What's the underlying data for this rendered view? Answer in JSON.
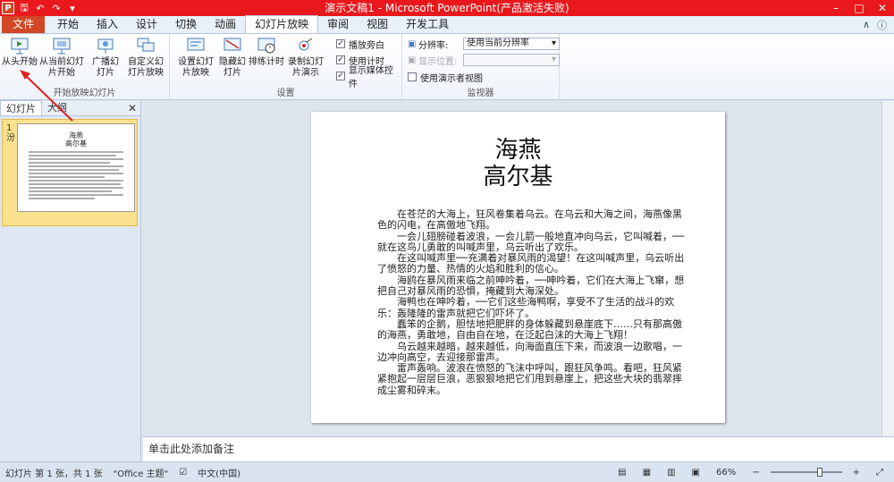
{
  "window": {
    "title": "演示文稿1 - Microsoft PowerPoint(产品激活失败)",
    "app_logo": "P",
    "controls": [
      "minimize",
      "maximize",
      "close"
    ]
  },
  "qat": {
    "save": "save-icon",
    "undo": "undo-icon",
    "redo": "redo-icon"
  },
  "tabs": [
    {
      "label": "文件"
    },
    {
      "label": "开始"
    },
    {
      "label": "插入"
    },
    {
      "label": "设计"
    },
    {
      "label": "切换"
    },
    {
      "label": "动画"
    },
    {
      "label": "幻灯片放映"
    },
    {
      "label": "审阅"
    },
    {
      "label": "视图"
    },
    {
      "label": "开发工具"
    }
  ],
  "ribbon": {
    "group_start": {
      "label": "开始放映幻灯片",
      "from_beginning": "从头开始",
      "from_current": "从当前幻灯片开始",
      "broadcast": "广播幻灯片",
      "custom": "自定义幻灯片放映"
    },
    "group_setup": {
      "label": "设置",
      "setup_show": "设置幻灯片放映",
      "hide_slide": "隐藏幻灯片",
      "rehearse": "排练计时",
      "record": "录制幻灯片演示",
      "play_narrations": "播放旁白",
      "use_timings": "使用计时",
      "show_media": "显示媒体控件"
    },
    "group_monitors": {
      "label": "监视器",
      "resolution_label": "分辨率:",
      "resolution_value": "使用当前分辨率",
      "show_on_label": "显示位置:",
      "presenter_view": "使用演示者视图"
    }
  },
  "left_pane": {
    "tab_slides": "幻灯片",
    "tab_outline": "大纲",
    "slide_number": "1",
    "slide_mark": "汾",
    "thumb_title": "海燕",
    "thumb_author": "高尔基"
  },
  "slide": {
    "title": "海燕",
    "author": "高尔基",
    "paragraphs": [
      "在苍茫的大海上，狂风卷集着乌云。在乌云和大海之间，海燕像黑色的闪电，在高傲地飞翔。",
      "一会儿翅膀碰着波浪，一会儿箭一般地直冲向乌云，它叫喊着，──就在这鸟儿勇敢的叫喊声里，乌云听出了欢乐。",
      "在这叫喊声里──充满着对暴风雨的渴望！在这叫喊声里，乌云听出了愤怒的力量、热情的火焰和胜利的信心。",
      "海鸥在暴风雨来临之前呻吟着，──呻吟着，它们在大海上飞窜，想把自己对暴风雨的恐惧，掩藏到大海深处。",
      "海鸭也在呻吟着，──它们这些海鸭啊，享受不了生活的战斗的欢乐：轰隆隆的雷声就把它们吓坏了。",
      "蠢笨的企鹅，胆怯地把肥胖的身体躲藏到悬崖底下……只有那高傲的海燕，勇敢地，自由自在地，在泛起白沫的大海上飞翔！",
      "乌云越来越暗，越来越低，向海面直压下来，而波浪一边歌唱，一边冲向高空，去迎接那雷声。",
      "雷声轰响。波浪在愤怒的飞沫中呼叫，跟狂风争鸣。看吧，狂风紧紧抱起一层层巨浪，恶狠狠地把它们甩到悬崖上，把这些大块的翡翠摔成尘雾和碎末。"
    ]
  },
  "notes": {
    "placeholder": "单击此处添加备注"
  },
  "statusbar": {
    "slide_info": "幻灯片 第 1 张，共 1 张",
    "theme": "\"Office 主题\"",
    "language": "中文(中国)",
    "zoom": "66%",
    "zoom_level": 0.66
  },
  "colors": {
    "titlebar": "#e8181c",
    "file_tab": "#d24726",
    "selected_slide": "#fbe18d",
    "annotation_arrow": "#e02020"
  }
}
